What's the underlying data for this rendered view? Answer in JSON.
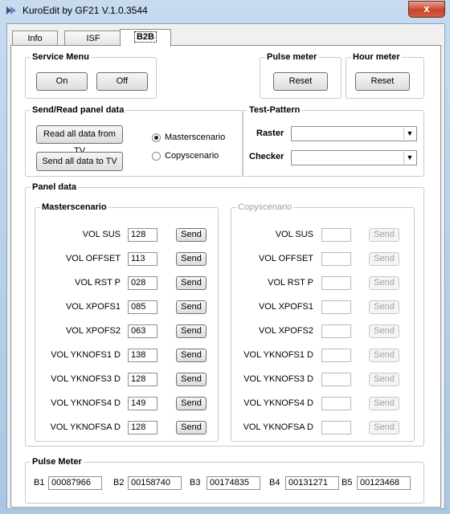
{
  "window": {
    "title": "KuroEdit by GF21 V.1.0.3544",
    "close": "x"
  },
  "tabs": [
    {
      "label": "Info"
    },
    {
      "label": "ISF"
    },
    {
      "label": "B2B"
    }
  ],
  "service_menu": {
    "title": "Service Menu",
    "on": "On",
    "off": "Off"
  },
  "pulse_meter_reset": {
    "title": "Pulse meter",
    "reset": "Reset"
  },
  "hour_meter": {
    "title": "Hour meter",
    "reset": "Reset"
  },
  "send_read": {
    "title": "Send/Read panel data",
    "read_all": "Read all data from TV",
    "send_all": "Send all data to TV",
    "radio_master": "Masterscenario",
    "radio_copy": "Copyscenario",
    "selected": "Masterscenario"
  },
  "test_pattern": {
    "title": "Test-Pattern",
    "raster_label": "Raster",
    "raster_value": "",
    "checker_label": "Checker",
    "checker_value": ""
  },
  "panel_data": {
    "title": "Panel data",
    "master": {
      "title": "Masterscenario",
      "rows": [
        {
          "label": "VOL SUS",
          "value": "128",
          "send": "Send"
        },
        {
          "label": "VOL OFFSET",
          "value": "113",
          "send": "Send"
        },
        {
          "label": "VOL RST P",
          "value": "028",
          "send": "Send"
        },
        {
          "label": "VOL XPOFS1",
          "value": "085",
          "send": "Send"
        },
        {
          "label": "VOL XPOFS2",
          "value": "063",
          "send": "Send"
        },
        {
          "label": "VOL YKNOFS1 D",
          "value": "138",
          "send": "Send"
        },
        {
          "label": "VOL YKNOFS3 D",
          "value": "128",
          "send": "Send"
        },
        {
          "label": "VOL YKNOFS4 D",
          "value": "149",
          "send": "Send"
        },
        {
          "label": "VOL YKNOFSA D",
          "value": "128",
          "send": "Send"
        }
      ]
    },
    "copy": {
      "title": "Copyscenario",
      "rows": [
        {
          "label": "VOL SUS",
          "value": "",
          "send": "Send"
        },
        {
          "label": "VOL OFFSET",
          "value": "",
          "send": "Send"
        },
        {
          "label": "VOL RST P",
          "value": "",
          "send": "Send"
        },
        {
          "label": "VOL XPOFS1",
          "value": "",
          "send": "Send"
        },
        {
          "label": "VOL XPOFS2",
          "value": "",
          "send": "Send"
        },
        {
          "label": "VOL YKNOFS1 D",
          "value": "",
          "send": "Send"
        },
        {
          "label": "VOL YKNOFS3 D",
          "value": "",
          "send": "Send"
        },
        {
          "label": "VOL YKNOFS4 D",
          "value": "",
          "send": "Send"
        },
        {
          "label": "VOL YKNOFSA D",
          "value": "",
          "send": "Send"
        }
      ]
    }
  },
  "pulse_meter": {
    "title": "Pulse Meter",
    "fields": [
      {
        "label": "B1",
        "value": "00087966"
      },
      {
        "label": "B2",
        "value": "00158740"
      },
      {
        "label": "B3",
        "value": "00174835"
      },
      {
        "label": "B4",
        "value": "00131271"
      },
      {
        "label": "B5",
        "value": "00123468"
      }
    ]
  }
}
